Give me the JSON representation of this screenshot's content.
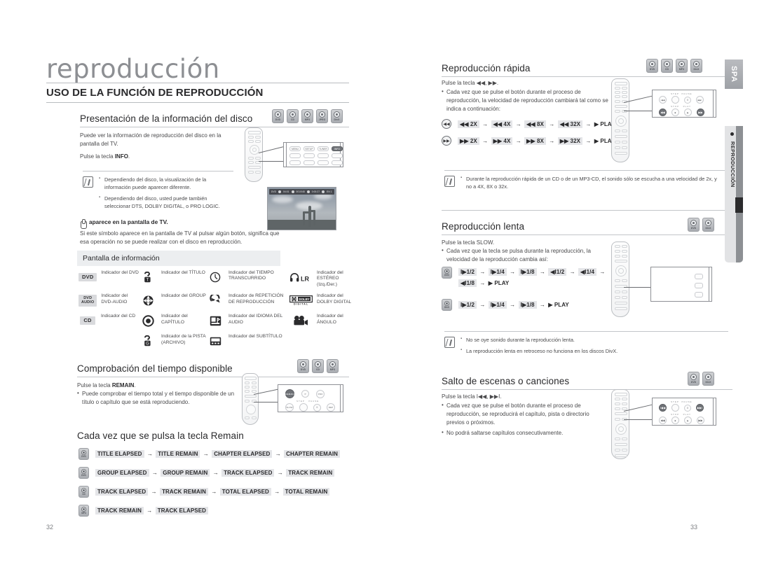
{
  "document": {
    "chapter_title": "reproducción",
    "section_title": "USO DE LA FUNCIÓN DE REPRODUCCIÓN",
    "page_left": "32",
    "page_right": "33",
    "rail_language": "SPA",
    "rail_tab": "REPRODUCCIÓN"
  },
  "disc_badges": {
    "dvd": "DVD",
    "cd": "CD",
    "mp3": "MP3",
    "jpeg": "JPEG",
    "divx": "DivX",
    "dvd_audio": "DVD AUDIO"
  },
  "sections": {
    "disc_info": {
      "heading": "Presentación de la información del disco",
      "badges": [
        "DVD",
        "CD",
        "MP3",
        "JPEG",
        "DivX"
      ],
      "intro": "Puede ver la información de reproducción del disco en la pantalla del TV.",
      "press": "Pulse la tecla ",
      "press_key": "INFO",
      "press_end": ".",
      "notes": [
        "Dependiendo del disco, la visualización de la información puede aparecer diferente.",
        "Dependiendo del disco, usted puede también seleccionar DTS, DOLBY DIGITAL, o PRO LOGIC."
      ],
      "hand_title": "aparece en la pantalla de TV.",
      "hand_body": "Si este símbolo aparece en la pantalla de TV al pulsar algún botón, significa que esa operación no se puede realizar con el disco en reproducción."
    },
    "info_panel": {
      "title": "Pantalla de información",
      "rows": [
        {
          "icon": "dvd-tag",
          "tag": "DVD",
          "label": "Indicador del DVD"
        },
        {
          "icon": "title-icon",
          "tag": "",
          "label": "Indicador del TÍTULO"
        },
        {
          "icon": "clock-icon",
          "tag": "",
          "label": "Indicador del TIEMPO TRANSCURRIDO"
        },
        {
          "icon": "headphone-lr-icon",
          "tag": "",
          "label": "Indicador del ESTÉREO (Izq./Der.)"
        },
        {
          "icon": "dvd-audio-tag",
          "tag": "DVD AUDIO",
          "label": "Indicador del DVD-AUDIO"
        },
        {
          "icon": "group-icon",
          "tag": "",
          "label": "Indicador del GROUP"
        },
        {
          "icon": "repeat-icon",
          "tag": "",
          "label": "Indicador de REPETICIÓN DE REPRODUCCIÓN"
        },
        {
          "icon": "dolby-digital-icon",
          "tag": "",
          "label": "Indicador del DOLBY DIGITAL"
        },
        {
          "icon": "cd-tag",
          "tag": "CD",
          "label": "Indicador del CD"
        },
        {
          "icon": "chapter-icon",
          "tag": "",
          "label": "Indicador del CAPÍTULO"
        },
        {
          "icon": "audio-lang-icon",
          "tag": "",
          "label": "Indicador del IDIOMA DEL AUDIO"
        },
        {
          "icon": "angle-camera-icon",
          "tag": "",
          "label": "Indicador del ÁNGULO"
        },
        {
          "icon": "",
          "tag": "",
          "label": ""
        },
        {
          "icon": "track-icon",
          "tag": "",
          "label": "Indicador de la PISTA (ARCHIVO)"
        },
        {
          "icon": "subtitle-icon",
          "tag": "",
          "label": "Indicador del SUBTÍTULO"
        },
        {
          "icon": "",
          "tag": "",
          "label": ""
        }
      ]
    },
    "remain_time": {
      "heading": "Comprobación del tiempo disponible",
      "badges": [
        "DVD",
        "CD",
        "MP3"
      ],
      "press": "Pulse la tecla ",
      "press_key": "REMAIN",
      "press_end": ".",
      "bullets": [
        "Puede comprobar el tiempo total y el tiempo disponible de un título o capítulo que se está reproduciendo."
      ]
    },
    "remain_sequences": {
      "heading": "Cada vez que se pulsa la tecla Remain",
      "rows": [
        {
          "badge": "DVD-VIDEO",
          "items": [
            "TITLE ELAPSED",
            "TITLE REMAIN",
            "CHAPTER ELAPSED",
            "CHAPTER REMAIN"
          ]
        },
        {
          "badge": "DVD-AUDIO",
          "items": [
            "GROUP ELAPSED",
            "GROUP REMAIN",
            "TRACK ELAPSED",
            "TRACK REMAIN"
          ]
        },
        {
          "badge": "CD",
          "items": [
            "TRACK ELAPSED",
            "TRACK REMAIN",
            "TOTAL ELAPSED",
            "TOTAL REMAIN"
          ]
        },
        {
          "badge": "MP3",
          "items": [
            "TRACK REMAIN",
            "TRACK ELAPSED"
          ]
        }
      ]
    },
    "fast_play": {
      "heading": "Reproducción rápida",
      "badges": [
        "DVD",
        "CD",
        "MP3",
        "DivX"
      ],
      "press": "Pulse la tecla ◀◀, ▶▶.",
      "bullets": [
        "Cada vez que se pulse el botón durante el proceso de reproducción, la velocidad de reproducción cambiará tal como se indica a continuación:"
      ],
      "sequences": [
        {
          "key": "rewind",
          "items": [
            "◀◀ 2X",
            "◀◀ 4X",
            "◀◀ 8X",
            "◀◀ 32X",
            "▶ PLAY"
          ]
        },
        {
          "key": "forward",
          "items": [
            "▶▶ 2X",
            "▶▶ 4X",
            "▶▶ 8X",
            "▶▶ 32X",
            "▶ PLAY"
          ]
        }
      ],
      "notes": [
        "Durante la reproducción rápida de un CD o de un MP3-CD, el sonido sólo se escucha a una velocidad de 2x, y no a 4X, 8X o 32x."
      ]
    },
    "slow_play": {
      "heading": "Reproducción lenta",
      "badges": [
        "DVD",
        "DivX"
      ],
      "press": "Pulse la tecla SLOW.",
      "bullets": [
        "Cada vez que la tecla se pulsa durante la reproducción, la velocidad de la reproducción cambia así:"
      ],
      "sequences": [
        {
          "badge": "DVD",
          "items": [
            "I▶1/2",
            "I▶1/4",
            "I▶1/8",
            "◀I1/2",
            "◀I1/4",
            "◀I1/8",
            "▶ PLAY"
          ]
        },
        {
          "badge": "DivX",
          "items": [
            "I▶1/2",
            "I▶1/4",
            "I▶1/8",
            "▶ PLAY"
          ]
        }
      ],
      "notes": [
        "No se oye sonido durante la reproducción lenta.",
        "La reproducción lenta en retroceso no funciona en los discos DivX."
      ]
    },
    "skip": {
      "heading": "Salto de escenas o canciones",
      "badges": [
        "DVD",
        "DivX"
      ],
      "press": "Pulse la tecla I◀◀, ▶▶I.",
      "bullets": [
        "Cada vez que se pulse el botón durante el proceso de reproducción, se reproducirá el capítulo, pista o directorio previos o próximos.",
        "No podrá saltarse capítulos consecutivamente."
      ]
    }
  },
  "remote_callouts": {
    "info_remote": {
      "labels": [
        "MENU",
        "INFO",
        "TUNER",
        "RETURN"
      ],
      "highlight": "INFO"
    },
    "remain_remote": {
      "labels": [
        "REMAIN",
        "STEP",
        "PAUSE",
        "SLOW",
        "STOP",
        "PLAY"
      ],
      "highlight": "REMAIN"
    },
    "fast_remote": {
      "labels": [
        "STEP",
        "PAUSE",
        "STOP",
        "PLAY"
      ],
      "highlight": "◀◀ ▶▶"
    },
    "skip_remote": {
      "labels": [
        "STEP",
        "PAUSE",
        "STOP",
        "PLAY"
      ],
      "highlight": "I◀◀ ▶▶I"
    }
  },
  "tv_osd": {
    "items": [
      "DVD",
      "04:01",
      "001/048",
      "0:00:27",
      "EN 1"
    ]
  },
  "colors": {
    "badge_bg": "#b4b7bb",
    "highlight": "#e4e5e8",
    "panel_bg": "#eceef0",
    "rule": "#c3c5c9",
    "text": "#4a4a4c"
  }
}
